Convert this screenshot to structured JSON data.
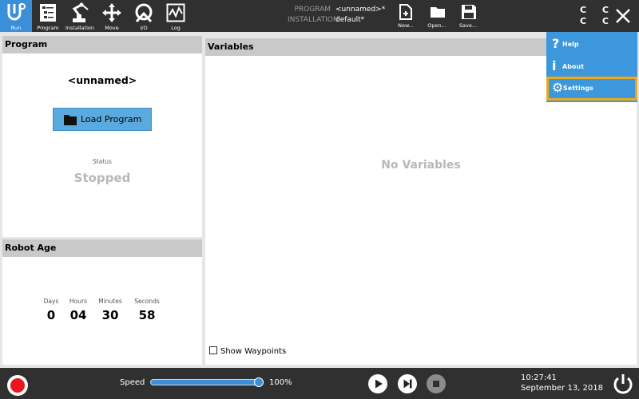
{
  "topbar": {
    "nav": [
      {
        "label": "Run",
        "icon": "ur-logo-icon",
        "active": true
      },
      {
        "label": "Program",
        "icon": "program-icon"
      },
      {
        "label": "Installation",
        "icon": "robot-arm-icon"
      },
      {
        "label": "Move",
        "icon": "move-arrows-icon"
      },
      {
        "label": "I/O",
        "icon": "io-icon"
      },
      {
        "label": "Log",
        "icon": "log-icon"
      }
    ],
    "program_key": "PROGRAM",
    "program_value": "<unnamed>*",
    "installation_key": "INSTALLATION",
    "installation_value": "default*",
    "file_buttons": [
      {
        "label": "New...",
        "icon": "new-file-icon"
      },
      {
        "label": "Open...",
        "icon": "open-folder-icon"
      },
      {
        "label": "Save...",
        "icon": "save-icon"
      }
    ],
    "cc_glyphs": "C C C C"
  },
  "program_panel": {
    "title": "Program",
    "program_name": "<unnamed>",
    "load_button": "Load Program",
    "status_label": "Status",
    "status_value": "Stopped"
  },
  "robot_age": {
    "title": "Robot Age",
    "units": [
      {
        "label": "Days",
        "value": "0"
      },
      {
        "label": "Hours",
        "value": "04"
      },
      {
        "label": "Minutes",
        "value": "30"
      },
      {
        "label": "Seconds",
        "value": "58"
      }
    ]
  },
  "variables_panel": {
    "title": "Variables",
    "empty_text": "No Variables",
    "show_waypoints_label": "Show Waypoints",
    "show_waypoints_checked": false
  },
  "menu": {
    "items": [
      {
        "label": "Help",
        "icon": "help-icon",
        "glyph": "?"
      },
      {
        "label": "About",
        "icon": "info-icon",
        "glyph": "i"
      },
      {
        "label": "Settings",
        "icon": "gear-icon",
        "glyph": "⚙",
        "selected": true
      }
    ]
  },
  "bottombar": {
    "speed_label": "Speed",
    "speed_value": "100%",
    "speed_fraction": 1.0,
    "time": "10:27:41",
    "date": "September 13, 2018"
  },
  "colors": {
    "accent": "#3a8fd8",
    "topbar": "#303030",
    "highlight": "#f0a81a",
    "record": "#e8141e"
  }
}
